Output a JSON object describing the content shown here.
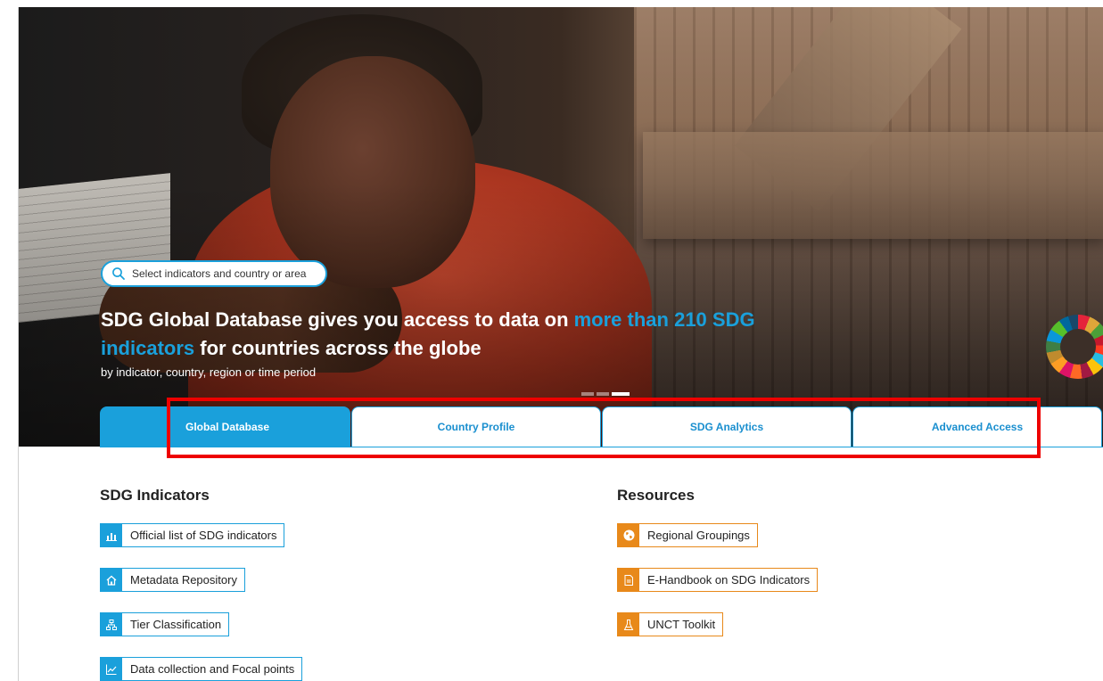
{
  "hero": {
    "search_placeholder": "Select indicators and country or area",
    "headline_part1": "SDG Global Database gives you access to data on ",
    "headline_highlight": "more than 210 SDG indicators",
    "headline_part2": " for countries across the globe",
    "subline": "by indicator, country, region or time period",
    "carousel_active_index": 3,
    "carousel_count": 3
  },
  "tabs": [
    {
      "label": "Global Database",
      "active": true
    },
    {
      "label": "Country Profile",
      "active": false
    },
    {
      "label": "SDG Analytics",
      "active": false
    },
    {
      "label": "Advanced Access",
      "active": false
    }
  ],
  "sdg_indicators": {
    "title": "SDG Indicators",
    "items": [
      {
        "label": "Official list of SDG indicators",
        "icon": "bar-chart-icon"
      },
      {
        "label": "Metadata Repository",
        "icon": "home-icon"
      },
      {
        "label": "Tier Classification",
        "icon": "hierarchy-icon"
      },
      {
        "label": "Data collection and Focal points",
        "icon": "line-chart-icon"
      }
    ]
  },
  "resources": {
    "title": "Resources",
    "items": [
      {
        "label": "Regional Groupings",
        "icon": "globe-icon"
      },
      {
        "label": "E-Handbook on SDG Indicators",
        "icon": "document-icon"
      },
      {
        "label": "UNCT Toolkit",
        "icon": "flask-icon"
      }
    ]
  },
  "colors": {
    "accent_blue": "#1aa0db",
    "accent_orange": "#e8891a",
    "highlight_red": "#ee0000"
  }
}
